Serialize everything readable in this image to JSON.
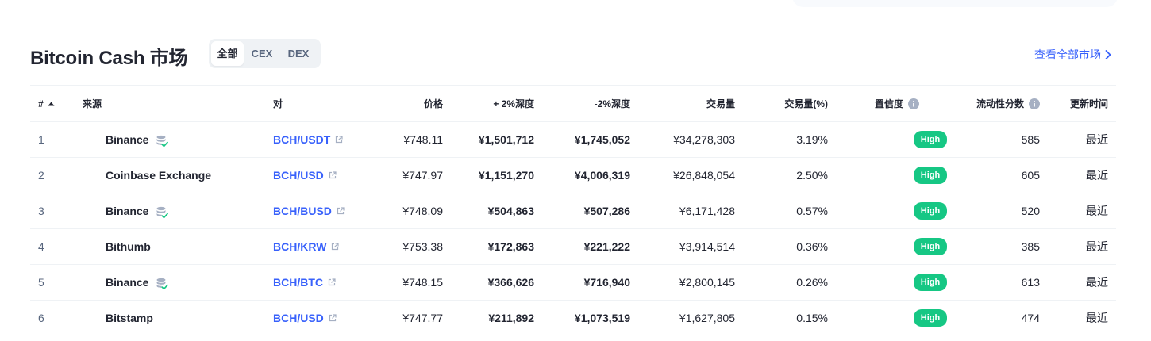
{
  "header": {
    "title": "Bitcoin Cash 市场",
    "tabs": [
      "全部",
      "CEX",
      "DEX"
    ],
    "active_tab": "全部",
    "view_all": "查看全部市场"
  },
  "table": {
    "columns": {
      "num": "#",
      "source": "来源",
      "pair": "对",
      "price": "价格",
      "depth_plus": "+ 2%深度",
      "depth_minus": "-2%深度",
      "volume": "交易量",
      "volume_pct": "交易量(%)",
      "confidence": "置信度",
      "liquidity": "流动性分数",
      "updated": "更新时间"
    },
    "sort": {
      "column": "#",
      "direction": "ascending",
      "icon": "caret-up-icon"
    },
    "rows": [
      {
        "num": "1",
        "source": "Binance",
        "verified": true,
        "pair": "BCH/USDT",
        "price": "¥748.11",
        "depth_plus": "¥1,501,712",
        "depth_minus": "¥1,745,052",
        "volume": "¥34,278,303",
        "volume_pct": "3.19%",
        "confidence": "High",
        "liquidity": "585",
        "updated": "最近"
      },
      {
        "num": "2",
        "source": "Coinbase Exchange",
        "verified": false,
        "pair": "BCH/USD",
        "price": "¥747.97",
        "depth_plus": "¥1,151,270",
        "depth_minus": "¥4,006,319",
        "volume": "¥26,848,054",
        "volume_pct": "2.50%",
        "confidence": "High",
        "liquidity": "605",
        "updated": "最近"
      },
      {
        "num": "3",
        "source": "Binance",
        "verified": true,
        "pair": "BCH/BUSD",
        "price": "¥748.09",
        "depth_plus": "¥504,863",
        "depth_minus": "¥507,286",
        "volume": "¥6,171,428",
        "volume_pct": "0.57%",
        "confidence": "High",
        "liquidity": "520",
        "updated": "最近"
      },
      {
        "num": "4",
        "source": "Bithumb",
        "verified": false,
        "pair": "BCH/KRW",
        "price": "¥753.38",
        "depth_plus": "¥172,863",
        "depth_minus": "¥221,222",
        "volume": "¥3,914,514",
        "volume_pct": "0.36%",
        "confidence": "High",
        "liquidity": "385",
        "updated": "最近"
      },
      {
        "num": "5",
        "source": "Binance",
        "verified": true,
        "pair": "BCH/BTC",
        "price": "¥748.15",
        "depth_plus": "¥366,626",
        "depth_minus": "¥716,940",
        "volume": "¥2,800,145",
        "volume_pct": "0.26%",
        "confidence": "High",
        "liquidity": "613",
        "updated": "最近"
      },
      {
        "num": "6",
        "source": "Bitstamp",
        "verified": false,
        "pair": "BCH/USD",
        "price": "¥747.77",
        "depth_plus": "¥211,892",
        "depth_minus": "¥1,073,519",
        "volume": "¥1,627,805",
        "volume_pct": "0.15%",
        "confidence": "High",
        "liquidity": "474",
        "updated": "最近"
      }
    ]
  },
  "colors": {
    "accent": "#3861fb",
    "high_badge": "#16c784",
    "muted": "#58667e",
    "text": "#222531",
    "divider": "#eff2f5"
  }
}
